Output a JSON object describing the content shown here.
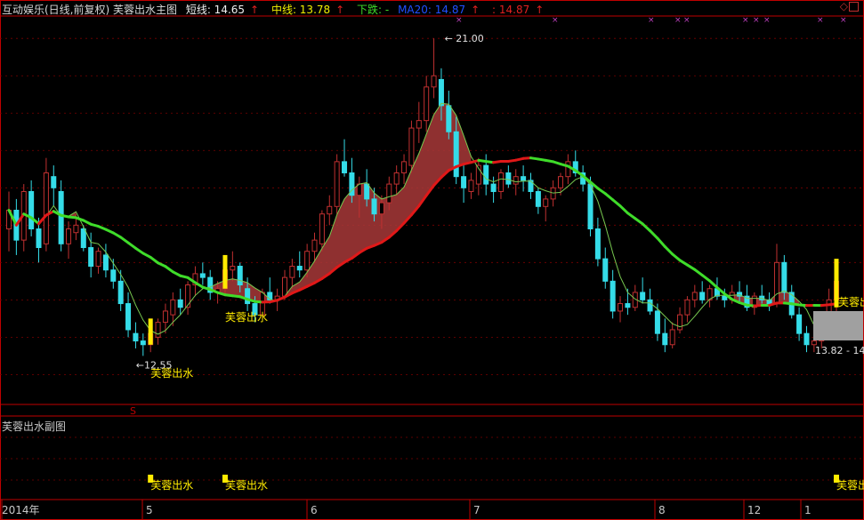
{
  "header": {
    "title": "互动娱乐(日线,前复权) 芙蓉出水主图",
    "short_label": "短线: 14.65",
    "mid_label": "中线: 13.78",
    "down_label": "下跌: -",
    "ma20_label": "MA20: 14.87",
    "extra_label": ": 14.87"
  },
  "sub_header": {
    "title": "芙蓉出水副图"
  },
  "colors": {
    "background": "#000000",
    "grid": "#7a0000",
    "axis": "#c00000",
    "bull": "#c03030",
    "bear": "#35dce8",
    "ma_up": "#e01818",
    "ma_down": "#3fdc2a",
    "thin_ma": "#78c850",
    "signal": "#ffeb00",
    "band": "#a83838",
    "gray_box": "#a0a0a0"
  },
  "chart_data": {
    "type": "candlestick",
    "price_range": [
      11.2,
      21.6
    ],
    "annotations": {
      "high": "21.00",
      "low": "12.55",
      "price_box": "13.82 - 14"
    },
    "signal_label": "芙蓉出水",
    "signal_label_right": "芙蓉出",
    "markers_top": [
      "×",
      "×",
      "×",
      "×",
      "×",
      "×",
      "×",
      "×",
      "×",
      "×"
    ],
    "marker_s": "S",
    "x_labels": [
      "2014年",
      "5",
      "6",
      "7",
      "8",
      "12",
      "1"
    ],
    "candles": [
      [
        15.9,
        16.9,
        15.3,
        16.4
      ],
      [
        16.4,
        16.7,
        15.2,
        15.6
      ],
      [
        15.6,
        17.1,
        15.3,
        16.9
      ],
      [
        16.9,
        17.2,
        15.7,
        15.9
      ],
      [
        15.9,
        16.2,
        15.0,
        15.4
      ],
      [
        15.5,
        17.8,
        15.3,
        17.4
      ],
      [
        17.3,
        17.6,
        16.5,
        17.0
      ],
      [
        16.9,
        17.2,
        15.3,
        15.5
      ],
      [
        15.5,
        16.1,
        15.1,
        15.9
      ],
      [
        15.8,
        16.3,
        15.6,
        16.0
      ],
      [
        15.9,
        16.0,
        15.3,
        15.4
      ],
      [
        15.4,
        15.8,
        14.6,
        14.9
      ],
      [
        14.9,
        15.4,
        14.7,
        15.3
      ],
      [
        15.2,
        15.5,
        14.6,
        14.8
      ],
      [
        14.8,
        15.1,
        14.3,
        14.5
      ],
      [
        14.5,
        14.8,
        13.7,
        13.9
      ],
      [
        13.9,
        14.2,
        13.0,
        13.2
      ],
      [
        13.1,
        13.4,
        12.7,
        12.9
      ],
      [
        12.9,
        13.1,
        12.5,
        12.8
      ],
      [
        12.8,
        13.2,
        12.6,
        13.1
      ],
      [
        13.0,
        13.5,
        12.8,
        13.4
      ],
      [
        13.4,
        13.9,
        13.1,
        13.7
      ],
      [
        13.6,
        14.2,
        13.3,
        14.0
      ],
      [
        14.0,
        14.3,
        13.6,
        13.8
      ],
      [
        13.8,
        14.5,
        13.6,
        14.4
      ],
      [
        14.4,
        14.9,
        14.1,
        14.7
      ],
      [
        14.7,
        15.0,
        14.4,
        14.6
      ],
      [
        14.6,
        14.8,
        14.0,
        14.2
      ],
      [
        14.2,
        14.5,
        13.9,
        14.3
      ],
      [
        14.3,
        14.9,
        14.1,
        14.8
      ],
      [
        14.8,
        15.3,
        14.5,
        14.9
      ],
      [
        14.9,
        15.0,
        14.2,
        14.4
      ],
      [
        14.3,
        14.6,
        13.7,
        13.9
      ],
      [
        13.9,
        14.1,
        13.4,
        13.6
      ],
      [
        13.6,
        14.3,
        13.5,
        14.2
      ],
      [
        14.2,
        14.6,
        13.9,
        14.0
      ],
      [
        14.0,
        14.3,
        13.7,
        14.1
      ],
      [
        14.1,
        14.8,
        14.0,
        14.6
      ],
      [
        14.6,
        15.1,
        14.3,
        14.9
      ],
      [
        14.9,
        15.3,
        14.6,
        14.8
      ],
      [
        14.8,
        15.5,
        14.6,
        15.3
      ],
      [
        15.3,
        15.8,
        15.0,
        15.6
      ],
      [
        15.5,
        16.4,
        15.3,
        16.3
      ],
      [
        16.3,
        16.8,
        16.0,
        16.5
      ],
      [
        16.5,
        17.9,
        16.3,
        17.7
      ],
      [
        17.7,
        18.3,
        17.3,
        17.4
      ],
      [
        17.4,
        17.8,
        16.6,
        16.8
      ],
      [
        16.8,
        17.3,
        16.2,
        17.1
      ],
      [
        17.1,
        17.5,
        16.5,
        16.7
      ],
      [
        16.7,
        17.0,
        16.1,
        16.3
      ],
      [
        16.3,
        16.8,
        15.9,
        16.6
      ],
      [
        16.6,
        17.3,
        16.4,
        17.1
      ],
      [
        17.1,
        17.6,
        16.8,
        17.4
      ],
      [
        17.4,
        17.9,
        17.1,
        17.7
      ],
      [
        17.6,
        18.8,
        17.4,
        18.6
      ],
      [
        18.6,
        19.3,
        18.2,
        18.8
      ],
      [
        18.8,
        20.0,
        18.5,
        19.7
      ],
      [
        19.7,
        21.0,
        19.4,
        20.0
      ],
      [
        19.9,
        20.2,
        18.8,
        19.2
      ],
      [
        19.2,
        19.6,
        18.3,
        18.5
      ],
      [
        18.5,
        18.9,
        17.1,
        17.3
      ],
      [
        17.3,
        17.6,
        16.6,
        17.0
      ],
      [
        16.9,
        17.4,
        16.7,
        17.2
      ],
      [
        17.1,
        17.8,
        16.8,
        17.6
      ],
      [
        17.6,
        17.9,
        16.8,
        17.1
      ],
      [
        17.1,
        17.3,
        16.6,
        16.9
      ],
      [
        16.9,
        17.5,
        16.7,
        17.4
      ],
      [
        17.4,
        17.6,
        17.0,
        17.1
      ],
      [
        17.1,
        17.5,
        16.8,
        17.3
      ],
      [
        17.3,
        17.6,
        16.9,
        17.2
      ],
      [
        17.2,
        17.4,
        16.7,
        16.9
      ],
      [
        16.9,
        17.0,
        16.3,
        16.5
      ],
      [
        16.5,
        16.8,
        16.1,
        16.7
      ],
      [
        16.7,
        17.2,
        16.5,
        17.0
      ],
      [
        17.0,
        17.4,
        16.8,
        17.3
      ],
      [
        17.3,
        17.9,
        17.1,
        17.7
      ],
      [
        17.7,
        18.0,
        17.3,
        17.4
      ],
      [
        17.4,
        17.6,
        16.9,
        17.1
      ],
      [
        17.1,
        17.3,
        15.7,
        15.9
      ],
      [
        15.9,
        16.2,
        14.9,
        15.1
      ],
      [
        15.1,
        15.4,
        14.3,
        14.5
      ],
      [
        14.5,
        14.8,
        13.5,
        13.7
      ],
      [
        13.7,
        14.1,
        13.4,
        13.9
      ],
      [
        13.9,
        14.3,
        13.6,
        13.8
      ],
      [
        13.8,
        14.4,
        13.7,
        14.2
      ],
      [
        14.2,
        14.6,
        13.9,
        14.0
      ],
      [
        14.0,
        14.3,
        13.6,
        13.7
      ],
      [
        13.7,
        13.9,
        12.9,
        13.1
      ],
      [
        13.1,
        13.5,
        12.6,
        12.8
      ],
      [
        12.8,
        13.4,
        12.7,
        13.2
      ],
      [
        13.2,
        13.8,
        13.1,
        13.6
      ],
      [
        13.6,
        14.1,
        13.4,
        14.0
      ],
      [
        14.0,
        14.4,
        13.8,
        14.2
      ],
      [
        14.2,
        14.5,
        13.9,
        14.0
      ],
      [
        14.0,
        14.4,
        13.8,
        14.3
      ],
      [
        14.3,
        14.6,
        14.0,
        14.1
      ],
      [
        14.1,
        14.3,
        13.8,
        14.0
      ],
      [
        14.0,
        14.4,
        13.9,
        14.2
      ],
      [
        14.2,
        14.5,
        13.9,
        14.1
      ],
      [
        14.1,
        14.4,
        13.7,
        13.8
      ],
      [
        13.8,
        14.2,
        13.6,
        14.1
      ],
      [
        14.1,
        14.4,
        13.9,
        14.0
      ],
      [
        14.0,
        14.2,
        13.7,
        13.9
      ],
      [
        13.9,
        15.5,
        13.8,
        15.0
      ],
      [
        15.0,
        15.2,
        14.0,
        14.2
      ],
      [
        14.2,
        14.4,
        13.5,
        13.6
      ],
      [
        13.6,
        13.8,
        12.9,
        13.1
      ],
      [
        13.1,
        13.3,
        12.6,
        12.8
      ],
      [
        12.8,
        13.0,
        12.6,
        12.9
      ],
      [
        12.9,
        13.3,
        12.7,
        13.1
      ],
      [
        13.1,
        14.3,
        13.0,
        14.0
      ],
      [
        14.0,
        14.8,
        13.6,
        14.5
      ]
    ]
  }
}
